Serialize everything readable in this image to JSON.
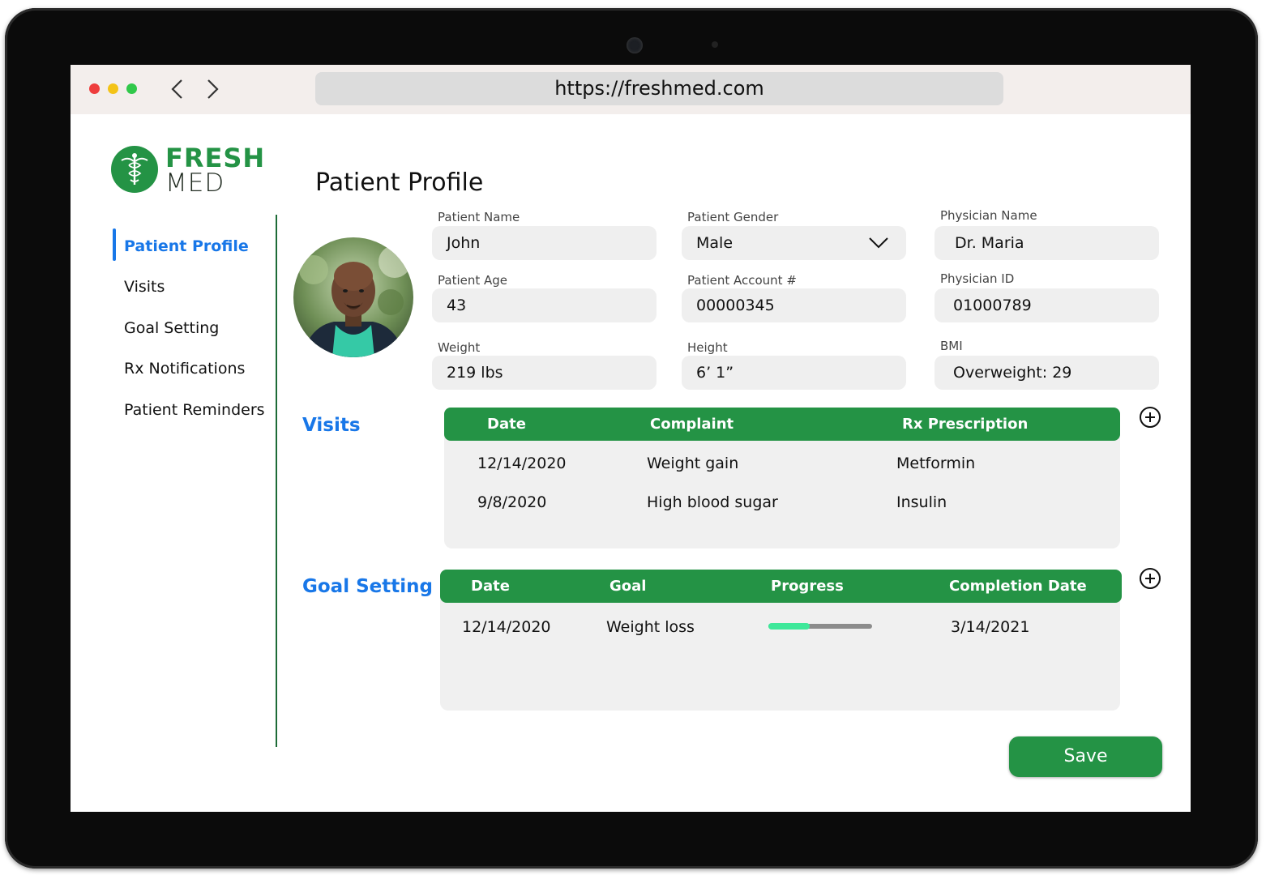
{
  "browser": {
    "url": "https://freshmed.com",
    "dots": [
      "#ee3d3d",
      "#f3c317",
      "#30c84a"
    ]
  },
  "logo": {
    "line1": "FRESH",
    "line2": "MED",
    "color": "#249345"
  },
  "sidebar": {
    "items": [
      {
        "label": "Patient Profile",
        "active": true
      },
      {
        "label": "Visits"
      },
      {
        "label": "Goal Setting"
      },
      {
        "label": "Rx Notifications"
      },
      {
        "label": "Patient Reminders"
      }
    ],
    "accent": "#1877e8"
  },
  "page_title": "Patient Profile",
  "fields": {
    "patient_name": {
      "label": "Patient Name",
      "value": "John"
    },
    "patient_gender": {
      "label": "Patient Gender",
      "value": "Male"
    },
    "physician_name": {
      "label": "Physician Name",
      "value": "Dr. Maria"
    },
    "patient_age": {
      "label": "Patient Age",
      "value": "43"
    },
    "patient_account": {
      "label": "Patient Account #",
      "value": "00000345"
    },
    "physician_id": {
      "label": "Physician ID",
      "value": "01000789"
    },
    "weight": {
      "label": "Weight",
      "value": "219 lbs"
    },
    "height": {
      "label": "Height",
      "value": "6’ 1”"
    },
    "bmi": {
      "label": "BMI",
      "value": "Overweight: 29"
    }
  },
  "visits": {
    "title": "Visits",
    "columns": [
      "Date",
      "Complaint",
      "Rx Prescription"
    ],
    "rows": [
      [
        "12/14/2020",
        "Weight gain",
        "Metformin"
      ],
      [
        "9/8/2020",
        "High blood sugar",
        "Insulin"
      ]
    ]
  },
  "goals": {
    "title": "Goal Setting",
    "columns": [
      "Date",
      "Goal",
      "Progress",
      "Completion Date"
    ],
    "rows": [
      {
        "date": "12/14/2020",
        "goal": "Weight loss",
        "progress": 0.4,
        "completion": "3/14/2021"
      }
    ]
  },
  "save_label": "Save",
  "colors": {
    "header_green": "#249345",
    "progress_fill": "#3ee89a"
  }
}
